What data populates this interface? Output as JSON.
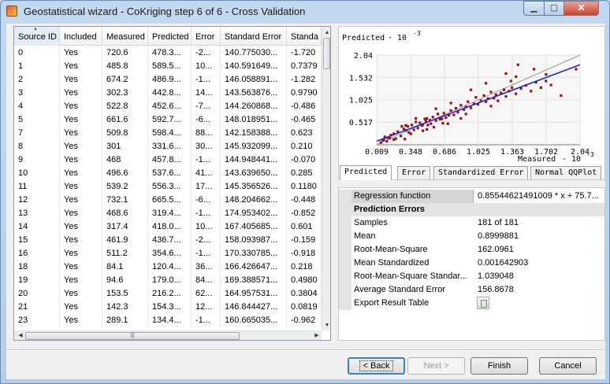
{
  "window": {
    "title": "Geostatistical wizard - CoKriging step 6 of 6 - Cross Validation",
    "min_glyph": "▁",
    "max_glyph": "▢",
    "close_glyph": "✕"
  },
  "table": {
    "columns": [
      "Source ID",
      "Included",
      "Measured",
      "Predicted",
      "Error",
      "Standard Error",
      "Standa"
    ],
    "rows": [
      [
        "0",
        "Yes",
        "720.6",
        "478.3...",
        "-2...",
        "140.775030...",
        "-1.720"
      ],
      [
        "1",
        "Yes",
        "485.8",
        "589.5...",
        "10...",
        "140.591649...",
        "0.7379"
      ],
      [
        "2",
        "Yes",
        "674.2",
        "486.9...",
        "-1...",
        "146.058891...",
        "-1.282"
      ],
      [
        "3",
        "Yes",
        "302.3",
        "442.8...",
        "14...",
        "143.563876...",
        "0.9790"
      ],
      [
        "4",
        "Yes",
        "522.8",
        "452.6...",
        "-7...",
        "144.260868...",
        "-0.486"
      ],
      [
        "5",
        "Yes",
        "661.6",
        "592.7...",
        "-6...",
        "148.018951...",
        "-0.465"
      ],
      [
        "7",
        "Yes",
        "509.8",
        "598.4...",
        "88...",
        "142.158388...",
        "0.623"
      ],
      [
        "8",
        "Yes",
        "301",
        "331.6...",
        "30...",
        "145.932099...",
        "0.210"
      ],
      [
        "9",
        "Yes",
        "468",
        "457.8...",
        "-1...",
        "144.948441...",
        "-0.070"
      ],
      [
        "10",
        "Yes",
        "496.6",
        "537.6...",
        "41...",
        "143.639650...",
        "0.285"
      ],
      [
        "11",
        "Yes",
        "539.2",
        "556.3...",
        "17...",
        "145.356526...",
        "0.1180"
      ],
      [
        "12",
        "Yes",
        "732.1",
        "665.5...",
        "-6...",
        "148.204662...",
        "-0.448"
      ],
      [
        "13",
        "Yes",
        "468.6",
        "319.4...",
        "-1...",
        "174.953402...",
        "-0.852"
      ],
      [
        "14",
        "Yes",
        "317.4",
        "418.0...",
        "10...",
        "167.405685...",
        "0.601"
      ],
      [
        "15",
        "Yes",
        "461.9",
        "436.7...",
        "-2...",
        "158.093987...",
        "-0.159"
      ],
      [
        "16",
        "Yes",
        "511.2",
        "354.6...",
        "-1...",
        "170.330785...",
        "-0.918"
      ],
      [
        "18",
        "Yes",
        "84.1",
        "120.4...",
        "36...",
        "166.426647...",
        "0.218"
      ],
      [
        "19",
        "Yes",
        "94.6",
        "179.0...",
        "84...",
        "169.388571...",
        "0.4980"
      ],
      [
        "20",
        "Yes",
        "153.5",
        "216.2...",
        "62...",
        "164.957531...",
        "0.3804"
      ],
      [
        "21",
        "Yes",
        "142.3",
        "154.3...",
        "12...",
        "146.844427...",
        "0.0819"
      ],
      [
        "23",
        "Yes",
        "289.1",
        "134.4...",
        "-1...",
        "160.665035...",
        "-0.962"
      ]
    ],
    "scroll_up_glyph": "▲",
    "scroll_down_glyph": "▼",
    "scroll_left_glyph": "◀",
    "scroll_right_glyph": "▶",
    "hthumb_grip": "|||"
  },
  "chart_data": {
    "type": "scatter",
    "y_label": "Predicted",
    "y_exp_label": "· 10",
    "y_exp_power": "-3",
    "x_label": "Measured",
    "x_exp_label": "· 10",
    "x_exp_power": "-3",
    "xlim": [
      0.009,
      2.04
    ],
    "ylim": [
      0.0,
      2.04
    ],
    "x_ticks": [
      "0.009",
      "0.348",
      "0.686",
      "1.025",
      "1.363",
      "1.702",
      "2.04"
    ],
    "y_ticks": [
      "0.517",
      "1.025",
      "1.532",
      "2.04"
    ],
    "y_tick_values": [
      0.517,
      1.025,
      1.532,
      2.04
    ],
    "grid": true,
    "point_color": "#a01010",
    "regression_color": "#1a2ad6",
    "reference_color": "#9a9a9a",
    "regression": {
      "slope": 0.85544621491009,
      "intercept": 0.0757
    },
    "points": [
      [
        0.72,
        0.48
      ],
      [
        0.49,
        0.59
      ],
      [
        0.67,
        0.49
      ],
      [
        0.3,
        0.44
      ],
      [
        0.52,
        0.45
      ],
      [
        0.66,
        0.59
      ],
      [
        0.51,
        0.6
      ],
      [
        0.3,
        0.33
      ],
      [
        0.47,
        0.46
      ],
      [
        0.5,
        0.54
      ],
      [
        0.54,
        0.56
      ],
      [
        0.73,
        0.67
      ],
      [
        0.47,
        0.32
      ],
      [
        0.32,
        0.42
      ],
      [
        0.46,
        0.44
      ],
      [
        0.51,
        0.35
      ],
      [
        0.08,
        0.12
      ],
      [
        0.09,
        0.18
      ],
      [
        0.15,
        0.22
      ],
      [
        0.14,
        0.15
      ],
      [
        0.29,
        0.13
      ],
      [
        0.05,
        0.05
      ],
      [
        0.07,
        0.1
      ],
      [
        0.11,
        0.08
      ],
      [
        0.12,
        0.16
      ],
      [
        0.18,
        0.25
      ],
      [
        0.2,
        0.14
      ],
      [
        0.22,
        0.3
      ],
      [
        0.25,
        0.2
      ],
      [
        0.28,
        0.36
      ],
      [
        0.33,
        0.28
      ],
      [
        0.36,
        0.45
      ],
      [
        0.38,
        0.34
      ],
      [
        0.4,
        0.52
      ],
      [
        0.42,
        0.38
      ],
      [
        0.44,
        0.5
      ],
      [
        0.55,
        0.48
      ],
      [
        0.57,
        0.63
      ],
      [
        0.6,
        0.55
      ],
      [
        0.62,
        0.7
      ],
      [
        0.64,
        0.58
      ],
      [
        0.68,
        0.72
      ],
      [
        0.7,
        0.62
      ],
      [
        0.75,
        0.78
      ],
      [
        0.78,
        0.68
      ],
      [
        0.8,
        0.83
      ],
      [
        0.82,
        0.74
      ],
      [
        0.85,
        0.9
      ],
      [
        0.88,
        0.8
      ],
      [
        0.9,
        0.86
      ],
      [
        0.92,
        0.98
      ],
      [
        0.95,
        0.84
      ],
      [
        0.98,
        0.93
      ],
      [
        1.0,
        1.08
      ],
      [
        1.02,
        0.92
      ],
      [
        1.05,
        1.0
      ],
      [
        1.08,
        1.12
      ],
      [
        1.1,
        0.98
      ],
      [
        1.12,
        1.05
      ],
      [
        1.15,
        1.2
      ],
      [
        1.18,
        1.06
      ],
      [
        1.2,
        1.14
      ],
      [
        1.22,
        1.0
      ],
      [
        1.25,
        1.18
      ],
      [
        1.28,
        1.25
      ],
      [
        1.3,
        1.1
      ],
      [
        1.33,
        1.22
      ],
      [
        1.36,
        1.3
      ],
      [
        1.4,
        1.16
      ],
      [
        1.45,
        1.28
      ],
      [
        1.5,
        1.35
      ],
      [
        1.55,
        1.22
      ],
      [
        1.6,
        1.42
      ],
      [
        1.65,
        1.3
      ],
      [
        1.7,
        1.45
      ],
      [
        1.75,
        1.36
      ],
      [
        1.4,
        1.55
      ],
      [
        1.58,
        1.72
      ],
      [
        1.7,
        1.6
      ],
      [
        1.42,
        1.82
      ],
      [
        1.3,
        1.62
      ],
      [
        1.85,
        1.12
      ],
      [
        2.0,
        1.72
      ],
      [
        0.95,
        1.25
      ],
      [
        1.1,
        1.4
      ],
      [
        0.6,
        0.82
      ],
      [
        0.75,
        0.95
      ],
      [
        0.9,
        0.7
      ],
      [
        0.4,
        0.6
      ],
      [
        0.35,
        0.25
      ],
      [
        0.85,
        0.6
      ],
      [
        1.15,
        0.88
      ],
      [
        0.26,
        0.42
      ],
      [
        0.18,
        0.12
      ],
      [
        0.58,
        0.4
      ],
      [
        1.35,
        1.45
      ]
    ]
  },
  "tabs": [
    "Predicted",
    "Error",
    "Standardized Error",
    "Normal QQPlot"
  ],
  "properties": {
    "regression_label": "Regression function",
    "regression_value": "0.85544621491009 * x + 75.7...",
    "category": "Prediction Errors",
    "rows": [
      {
        "key": "Samples",
        "value": "181 of 181"
      },
      {
        "key": "Mean",
        "value": "0.8999881"
      },
      {
        "key": "Root-Mean-Square",
        "value": "162.0961"
      },
      {
        "key": "Mean Standardized",
        "value": "0.001642903"
      },
      {
        "key": "Root-Mean-Square Standar...",
        "value": "1.039048"
      },
      {
        "key": "Average Standard Error",
        "value": "156.8678"
      }
    ],
    "export_label": "Export Result Table"
  },
  "buttons": {
    "back": "< Back",
    "next": "Next >",
    "finish": "Finish",
    "cancel": "Cancel"
  },
  "grip_glyph": "⋰"
}
